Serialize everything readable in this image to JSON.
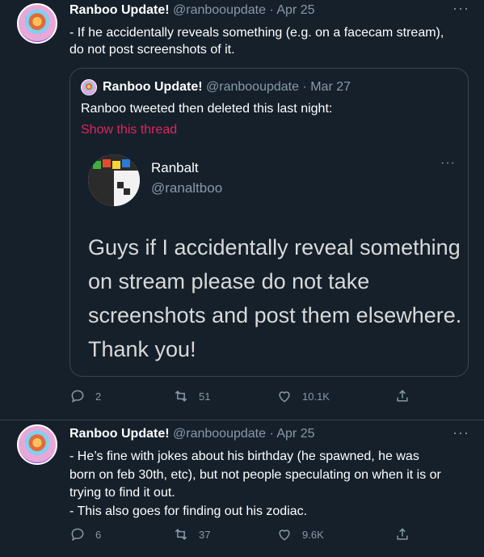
{
  "tweet1": {
    "name": "Ranboo Update!",
    "handle": "@ranbooupdate",
    "date": "· Apr 25",
    "more": "···",
    "text": "- If he accidentally reveals something (e.g. on a facecam stream),\ndo not post screenshots of it.",
    "quote": {
      "name": "Ranboo Update!",
      "handle": "@ranbooupdate",
      "date": "· Mar 27",
      "text": "Ranboo tweeted then deleted this last night:",
      "link": "Show this thread",
      "embed": {
        "name": "Ranbalt",
        "handle": "@ranaltboo",
        "more": "···",
        "text": "Guys if I accidentally reveal something on stream please do not take screenshots and post them elsewhere. Thank you!"
      }
    },
    "actions": {
      "replies": "2",
      "retweets": "51",
      "likes": "10.1K"
    }
  },
  "tweet2": {
    "name": "Ranboo Update!",
    "handle": "@ranbooupdate",
    "date": "· Apr 25",
    "more": "···",
    "text": "- He’s fine with jokes about his birthday (he spawned, he was\nborn on feb 30th, etc), but not people speculating on when it is or\ntrying to find it out.\n- This also goes for finding out his zodiac.",
    "actions": {
      "replies": "6",
      "retweets": "37",
      "likes": "9.6K"
    }
  },
  "icons": [
    "reply-icon",
    "retweet-icon",
    "like-icon",
    "share-icon",
    "more-icon"
  ],
  "colors": {
    "background": "#15202b",
    "muted": "#8899a6",
    "link": "#e0245e",
    "border": "#38444d"
  }
}
